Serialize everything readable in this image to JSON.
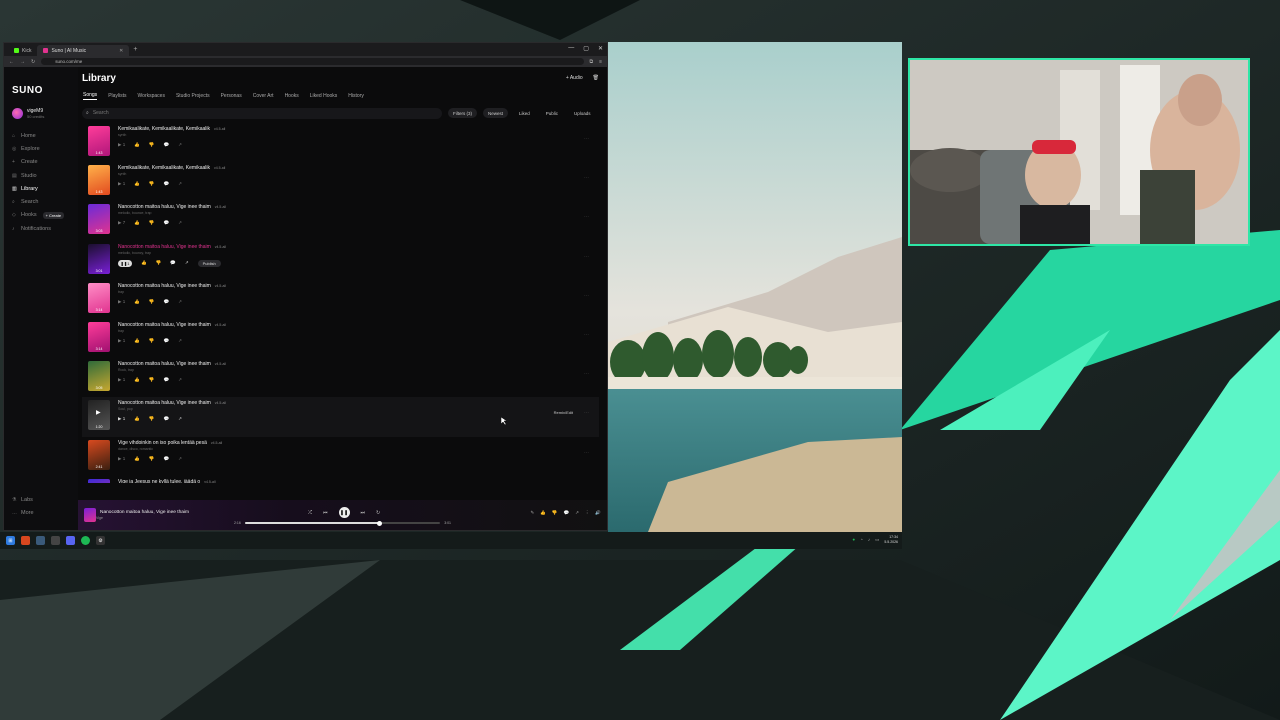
{
  "browser": {
    "tabs": [
      {
        "label": "Kick",
        "active": false,
        "favicon_color": "#53fc18"
      },
      {
        "label": "Suno | AI Music",
        "active": true,
        "favicon_color": "#e1338f"
      }
    ],
    "new_tab": "+",
    "url": "suno.com/me",
    "window_controls": [
      "—",
      "▢",
      "✕"
    ]
  },
  "sidebar": {
    "logo": "SUNO",
    "user": {
      "name": "vigeM9",
      "credits": "50 credits"
    },
    "items": [
      {
        "label": "Home",
        "icon": "home-icon"
      },
      {
        "label": "Explore",
        "icon": "compass-icon"
      },
      {
        "label": "Create",
        "icon": "plus-icon"
      },
      {
        "label": "Studio",
        "icon": "studio-icon"
      },
      {
        "label": "Library",
        "icon": "library-icon",
        "active": true
      },
      {
        "label": "Search",
        "icon": "search-icon"
      },
      {
        "label": "Hooks",
        "icon": "hooks-icon",
        "badge": "+ Create"
      },
      {
        "label": "Notifications",
        "icon": "bell-icon"
      }
    ],
    "footer": [
      {
        "label": "Labs"
      },
      {
        "label": "More"
      }
    ]
  },
  "header": {
    "title": "Library",
    "audio_button": "+ Audio"
  },
  "tabs": [
    "Songs",
    "Playlists",
    "Workspaces",
    "Studio Projects",
    "Personas",
    "Cover Art",
    "Hooks",
    "Liked Hooks",
    "History"
  ],
  "active_tab": "Songs",
  "toolbar": {
    "search_placeholder": "Search",
    "filters": "Filters (3)",
    "sort": "Newest",
    "liked": "Liked",
    "public": "Public",
    "uploads": "Uploads"
  },
  "songs": [
    {
      "title": "Kemikaalikate, Kemikaalikate, Kemikaalik",
      "version": "v4.5-all",
      "tags": "synth",
      "duration": "1:43",
      "colors": [
        "#ff3d9a",
        "#b0167a"
      ],
      "likes": "1"
    },
    {
      "title": "Kemikaalikate, Kemikaalikate, Kemikaalik",
      "version": "v4.5-all",
      "tags": "synth",
      "duration": "1:43",
      "colors": [
        "#ffb24a",
        "#e24a1f"
      ],
      "likes": "1"
    },
    {
      "title": "Nanocotton maitoa haluu, Vige inee thaim",
      "version": "v4.5-all",
      "tags": "melodic, bounce, trap",
      "duration": "3:03",
      "colors": [
        "#6a2bd8",
        "#e1338f"
      ],
      "likes": "7"
    },
    {
      "title": "Nanocotton maitoa haluu, Vige inee thaim",
      "version": "v4.5-all",
      "tags": "melodic, bouncy, trap",
      "duration": "3:01",
      "colors": [
        "#1b0f2e",
        "#7a1fd8"
      ],
      "likes": "1",
      "playing": true,
      "publish": "Publish"
    },
    {
      "title": "Nanocotton maitoa haluu, Vige inee thaim",
      "version": "v4.5-all",
      "tags": "trap",
      "duration": "3:14",
      "colors": [
        "#ff8fc7",
        "#e1338f"
      ],
      "likes": "1"
    },
    {
      "title": "Nanocotton maitoa haluu, Vige inee thaim",
      "version": "v4.5-all",
      "tags": "trap",
      "duration": "3:14",
      "colors": [
        "#ff3d9a",
        "#a01070"
      ],
      "likes": "1"
    },
    {
      "title": "Nanocotton maitoa haluu, Vige inee thaim",
      "version": "v4.5-all",
      "tags": "Rock, trap",
      "duration": "3:05",
      "colors": [
        "#2f6b3a",
        "#c8a830"
      ],
      "likes": "1"
    },
    {
      "title": "Nanocotton maitoa haluu, Vige inee thaim",
      "version": "v4.5-all",
      "tags": "Soul, pop",
      "duration": "1:20",
      "colors": [
        "#222222",
        "#555555"
      ],
      "likes": "1",
      "hover": true,
      "remix": "Remix/Edit"
    },
    {
      "title": "Vige vihdoinkin on iso poika lentää pesä",
      "version": "v4.5-all",
      "tags": "dance, disco, romantic",
      "duration": "2:41",
      "colors": [
        "#d84a1f",
        "#3a1f10"
      ],
      "likes": "1"
    },
    {
      "title": "Vige ja Jeesus ne kyllä tulee, jäädä o",
      "version": "v4.5-all",
      "tags": "",
      "duration": "",
      "colors": [
        "#3b2bd8",
        "#e1338f"
      ],
      "likes": "1"
    }
  ],
  "player": {
    "title": "Nanocotton maitoa haluu, Vige inee thaim",
    "artist": "Vige",
    "elapsed": "2:16",
    "total": "3:01",
    "progress": 0.69
  },
  "taskbar": {
    "clock_time": "17:34",
    "clock_date": "5.5.2026"
  }
}
